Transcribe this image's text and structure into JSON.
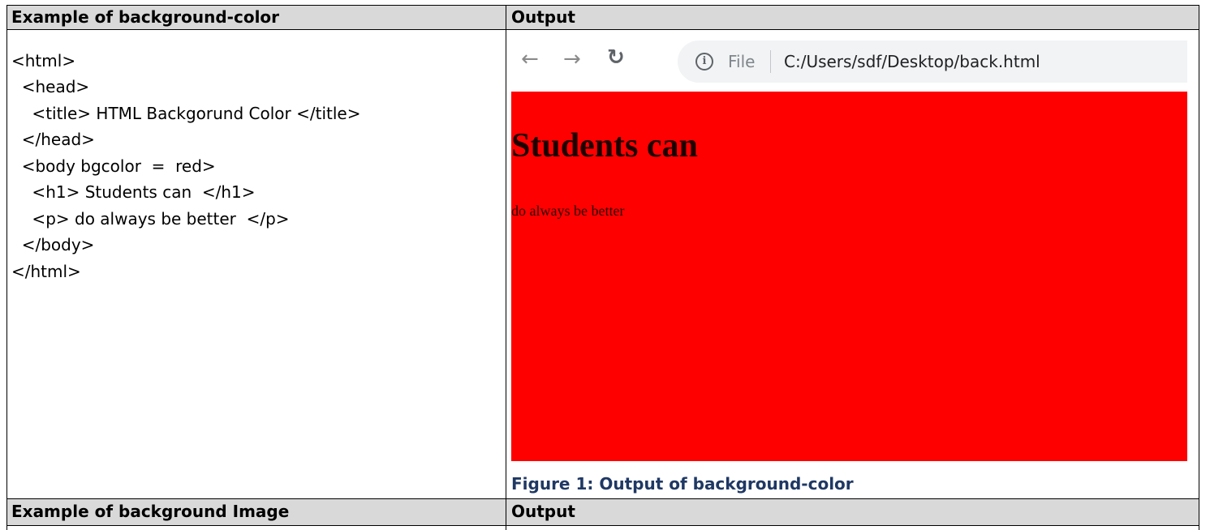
{
  "table": {
    "header1": {
      "left": "Example of background-color",
      "right": "Output"
    },
    "header2": {
      "left": "Example of background Image",
      "right": "Output"
    }
  },
  "code": {
    "lines": [
      "<html>",
      "  <head>",
      "    <title> HTML Backgorund Color </title>",
      "  </head>",
      "  <body bgcolor  =  red>",
      "    <h1> Students can  </h1>",
      "    <p> do always be better  </p>",
      "  </body>",
      "</html>"
    ]
  },
  "browser": {
    "back_icon": "back-arrow-icon",
    "forward_icon": "forward-arrow-icon",
    "reload_icon": "reload-icon",
    "info_icon": "info-icon",
    "file_label": "File",
    "url": "C:/Users/sdf/Desktop/back.html"
  },
  "output": {
    "background_color": "#ff0000",
    "heading": "Students can",
    "paragraph": "do always be better"
  },
  "caption": "Figure 1: Output of background-color",
  "colors": {
    "header_bg": "#d9d9d9",
    "caption": "#1f3864",
    "border": "#000000"
  }
}
